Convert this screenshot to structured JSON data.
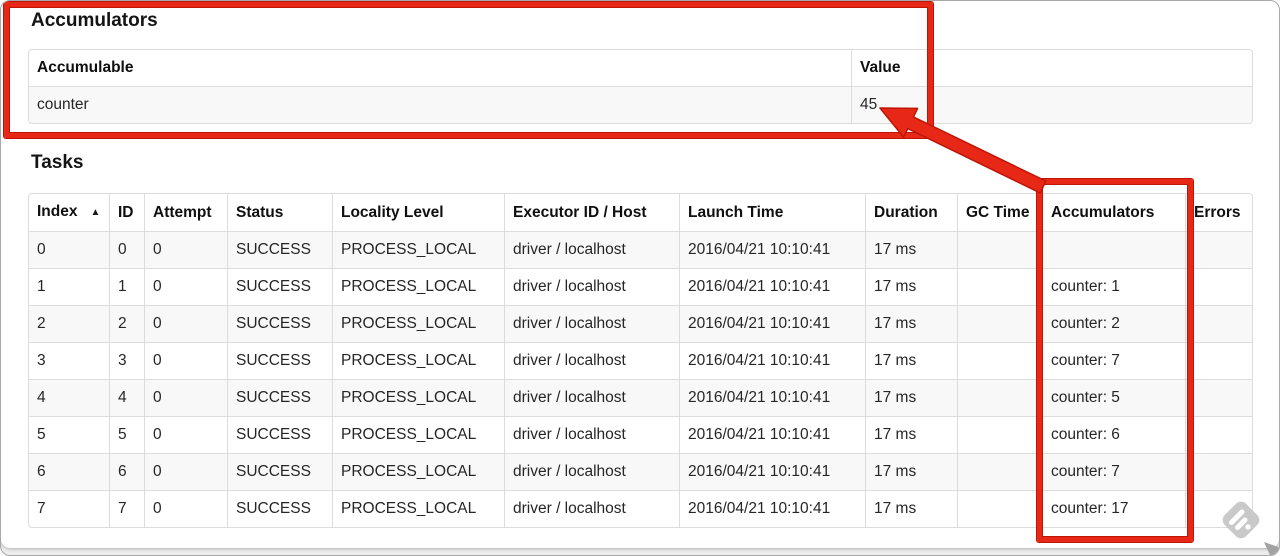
{
  "accumulators_section": {
    "title": "Accumulators",
    "table": {
      "headers": [
        "Accumulable",
        "Value"
      ],
      "rows": [
        [
          "counter",
          "45"
        ]
      ]
    }
  },
  "tasks_section": {
    "title": "Tasks",
    "table": {
      "sort_icon": "▲",
      "headers": [
        "Index",
        "ID",
        "Attempt",
        "Status",
        "Locality Level",
        "Executor ID / Host",
        "Launch Time",
        "Duration",
        "GC Time",
        "Accumulators",
        "Errors"
      ],
      "rows": [
        [
          "0",
          "0",
          "0",
          "SUCCESS",
          "PROCESS_LOCAL",
          "driver / localhost",
          "2016/04/21 10:10:41",
          "17 ms",
          "",
          "",
          ""
        ],
        [
          "1",
          "1",
          "0",
          "SUCCESS",
          "PROCESS_LOCAL",
          "driver / localhost",
          "2016/04/21 10:10:41",
          "17 ms",
          "",
          "counter: 1",
          ""
        ],
        [
          "2",
          "2",
          "0",
          "SUCCESS",
          "PROCESS_LOCAL",
          "driver / localhost",
          "2016/04/21 10:10:41",
          "17 ms",
          "",
          "counter: 2",
          ""
        ],
        [
          "3",
          "3",
          "0",
          "SUCCESS",
          "PROCESS_LOCAL",
          "driver / localhost",
          "2016/04/21 10:10:41",
          "17 ms",
          "",
          "counter: 7",
          ""
        ],
        [
          "4",
          "4",
          "0",
          "SUCCESS",
          "PROCESS_LOCAL",
          "driver / localhost",
          "2016/04/21 10:10:41",
          "17 ms",
          "",
          "counter: 5",
          ""
        ],
        [
          "5",
          "5",
          "0",
          "SUCCESS",
          "PROCESS_LOCAL",
          "driver / localhost",
          "2016/04/21 10:10:41",
          "17 ms",
          "",
          "counter: 6",
          ""
        ],
        [
          "6",
          "6",
          "0",
          "SUCCESS",
          "PROCESS_LOCAL",
          "driver / localhost",
          "2016/04/21 10:10:41",
          "17 ms",
          "",
          "counter: 7",
          ""
        ],
        [
          "7",
          "7",
          "0",
          "SUCCESS",
          "PROCESS_LOCAL",
          "driver / localhost",
          "2016/04/21 10:10:41",
          "17 ms",
          "",
          "counter: 17",
          ""
        ]
      ]
    }
  },
  "annotations": {
    "box_color": "#e82817",
    "box_outline_color": "#bf1508"
  },
  "watermark": {
    "name": "skitch",
    "color": "#c9c9c9"
  }
}
